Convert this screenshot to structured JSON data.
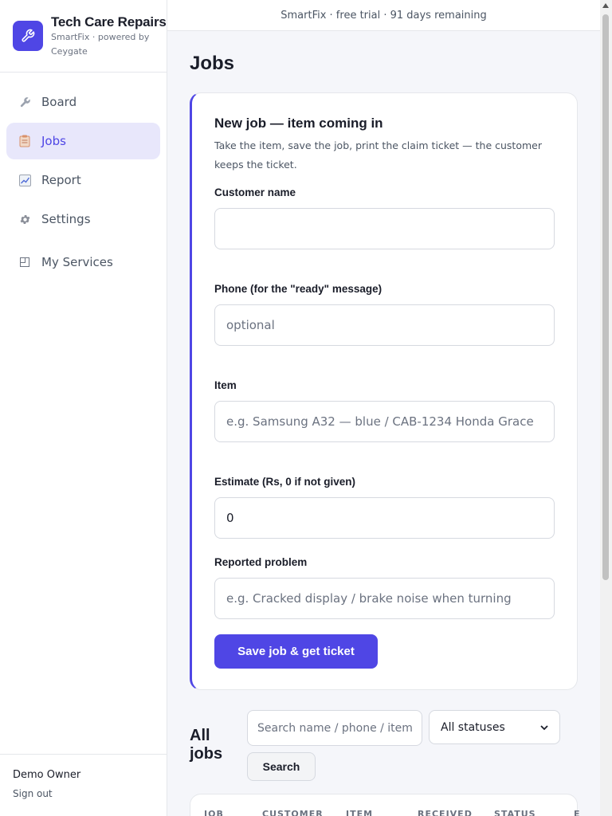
{
  "brand": {
    "name": "Tech Care Repairs",
    "subtitle": "SmartFix · powered by Ceygate",
    "logo_icon": "wrench-icon",
    "accent": "#4f46e5"
  },
  "sidebar": {
    "items": [
      {
        "label": "Board",
        "icon": "wrench-icon",
        "active": false
      },
      {
        "label": "Jobs",
        "icon": "clipboard-icon",
        "active": true
      },
      {
        "label": "Report",
        "icon": "chart-icon",
        "active": false
      },
      {
        "label": "Settings",
        "icon": "gear-icon",
        "active": false
      },
      {
        "label": "My Services",
        "icon": "window-icon",
        "active": false
      }
    ]
  },
  "user": {
    "name": "Demo Owner",
    "sign_out": "Sign out"
  },
  "trial_banner": "SmartFix · free trial · 91 days remaining",
  "page_title": "Jobs",
  "new_job": {
    "title": "New job — item coming in",
    "description": "Take the item, save the job, print the claim ticket — the customer keeps the ticket.",
    "fields": {
      "customer": {
        "label": "Customer name",
        "value": "",
        "placeholder": ""
      },
      "phone": {
        "label": "Phone (for the \"ready\" message)",
        "value": "",
        "placeholder": "optional"
      },
      "item": {
        "label": "Item",
        "value": "",
        "placeholder": "e.g. Samsung A32 — blue / CAB-1234 Honda Grace"
      },
      "estimate": {
        "label": "Estimate (Rs, 0 if not given)",
        "value": "0",
        "placeholder": ""
      },
      "problem": {
        "label": "Reported problem",
        "value": "",
        "placeholder": "e.g. Cracked display / brake noise when turning"
      }
    },
    "save_label": "Save job & get ticket"
  },
  "all_jobs": {
    "title_line1": "All",
    "title_line2": "jobs",
    "search_placeholder": "Search name / phone / item",
    "status_filter": "All statuses",
    "search_label": "Search",
    "columns": [
      "JOB",
      "CUSTOMER",
      "ITEM",
      "RECEIVED",
      "STATUS",
      "E"
    ]
  }
}
